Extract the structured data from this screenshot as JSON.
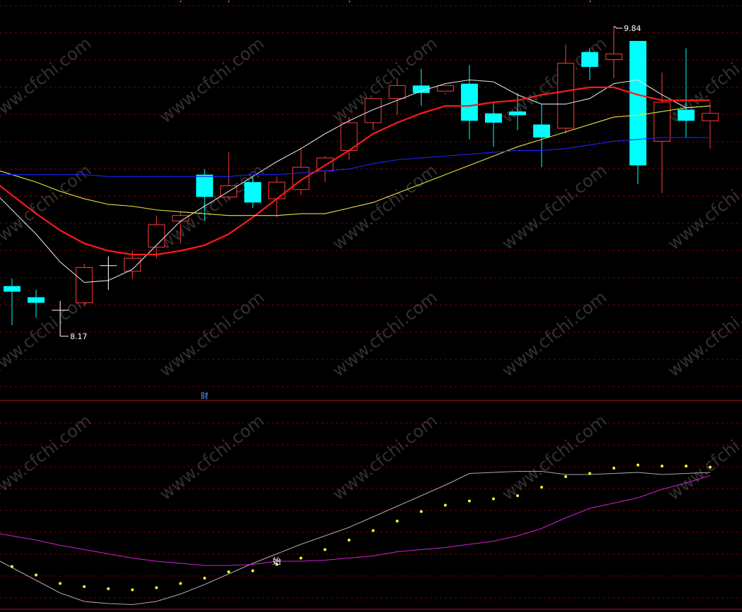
{
  "watermark": "www.cfchi.com",
  "colors": {
    "bg": "#000000",
    "grid": "#7a0000",
    "divider": "#b01020",
    "up": "#ff3b3b",
    "down": "#00ffff",
    "ma_white": "#e0e0e0",
    "ma_red": "#ff1a1a",
    "ma_yellow": "#e6e640",
    "ma_blue": "#2020ff",
    "ind_gray": "#a8a8a8",
    "ind_magenta": "#d020d0",
    "ind_dots": "#ffff20",
    "label": "#ffffff",
    "marker_blue": "#5a9cff"
  },
  "chart_data": [
    {
      "type": "candlestick",
      "panel": "main",
      "price_range": [
        7.9,
        9.95
      ],
      "annotations": [
        {
          "text": "9.84",
          "value": 9.84,
          "index": 25
        },
        {
          "text": "8.17",
          "value": 8.17,
          "index": 2
        }
      ],
      "marker_text": "财",
      "marker_index": 8,
      "candles": [
        {
          "o": 8.44,
          "h": 8.48,
          "l": 8.23,
          "c": 8.41,
          "dir": "down"
        },
        {
          "o": 8.38,
          "h": 8.42,
          "l": 8.27,
          "c": 8.35,
          "dir": "down"
        },
        {
          "o": 8.31,
          "h": 8.36,
          "l": 8.17,
          "c": 8.31,
          "dir": "flat"
        },
        {
          "o": 8.35,
          "h": 8.56,
          "l": 8.33,
          "c": 8.54,
          "dir": "up"
        },
        {
          "o": 8.55,
          "h": 8.6,
          "l": 8.42,
          "c": 8.55,
          "dir": "flat"
        },
        {
          "o": 8.52,
          "h": 8.63,
          "l": 8.48,
          "c": 8.59,
          "dir": "up"
        },
        {
          "o": 8.65,
          "h": 8.82,
          "l": 8.59,
          "c": 8.77,
          "dir": "up"
        },
        {
          "o": 8.79,
          "h": 8.84,
          "l": 8.67,
          "c": 8.82,
          "dir": "up"
        },
        {
          "o": 9.04,
          "h": 9.07,
          "l": 8.79,
          "c": 8.92,
          "dir": "down"
        },
        {
          "o": 8.92,
          "h": 9.16,
          "l": 8.9,
          "c": 8.98,
          "dir": "up"
        },
        {
          "o": 9.0,
          "h": 9.03,
          "l": 8.86,
          "c": 8.89,
          "dir": "down"
        },
        {
          "o": 8.91,
          "h": 9.03,
          "l": 8.81,
          "c": 9.0,
          "dir": "up"
        },
        {
          "o": 8.96,
          "h": 9.18,
          "l": 8.93,
          "c": 9.08,
          "dir": "up"
        },
        {
          "o": 9.06,
          "h": 9.14,
          "l": 9.0,
          "c": 9.13,
          "dir": "up"
        },
        {
          "o": 9.17,
          "h": 9.35,
          "l": 9.12,
          "c": 9.32,
          "dir": "up"
        },
        {
          "o": 9.32,
          "h": 9.44,
          "l": 9.28,
          "c": 9.45,
          "dir": "up"
        },
        {
          "o": 9.45,
          "h": 9.56,
          "l": 9.36,
          "c": 9.52,
          "dir": "up"
        },
        {
          "o": 9.52,
          "h": 9.61,
          "l": 9.41,
          "c": 9.48,
          "dir": "down"
        },
        {
          "o": 9.49,
          "h": 9.47,
          "l": 9.48,
          "c": 9.52,
          "dir": "up"
        },
        {
          "o": 9.53,
          "h": 9.63,
          "l": 9.23,
          "c": 9.33,
          "dir": "down"
        },
        {
          "o": 9.37,
          "h": 9.43,
          "l": 9.19,
          "c": 9.32,
          "dir": "down"
        },
        {
          "o": 9.38,
          "h": 9.48,
          "l": 9.28,
          "c": 9.36,
          "dir": "down"
        },
        {
          "o": 9.31,
          "h": 9.42,
          "l": 9.08,
          "c": 9.24,
          "dir": "down"
        },
        {
          "o": 9.29,
          "h": 9.74,
          "l": 9.26,
          "c": 9.64,
          "dir": "up"
        },
        {
          "o": 9.7,
          "h": 9.72,
          "l": 9.55,
          "c": 9.62,
          "dir": "down"
        },
        {
          "o": 9.66,
          "h": 9.84,
          "l": 9.56,
          "c": 9.69,
          "dir": "up"
        },
        {
          "o": 9.76,
          "h": 9.76,
          "l": 8.99,
          "c": 9.09,
          "dir": "down"
        },
        {
          "o": 9.22,
          "h": 9.59,
          "l": 8.94,
          "c": 9.43,
          "dir": "up"
        },
        {
          "o": 9.39,
          "h": 9.72,
          "l": 9.24,
          "c": 9.33,
          "dir": "down"
        },
        {
          "o": 9.33,
          "h": 9.43,
          "l": 9.18,
          "c": 9.37,
          "dir": "up"
        }
      ],
      "series": [
        {
          "color_key": "ma_white",
          "values": [
            8.85,
            8.72,
            8.57,
            8.46,
            8.47,
            8.53,
            8.66,
            8.79,
            8.87,
            8.95,
            9.03,
            9.11,
            9.18,
            9.26,
            9.33,
            9.39,
            9.44,
            9.49,
            9.53,
            9.55,
            9.54,
            9.47,
            9.42,
            9.42,
            9.45,
            9.53,
            9.55,
            9.47,
            9.4,
            9.41
          ]
        },
        {
          "color_key": "ma_red",
          "values": [
            8.93,
            8.83,
            8.74,
            8.67,
            8.63,
            8.61,
            8.61,
            8.63,
            8.66,
            8.72,
            8.81,
            8.91,
            9.01,
            9.09,
            9.17,
            9.26,
            9.32,
            9.37,
            9.41,
            9.41,
            9.43,
            9.44,
            9.47,
            9.49,
            9.51,
            9.51,
            9.47,
            9.44,
            9.44,
            9.44
          ]
        },
        {
          "color_key": "ma_yellow",
          "values": [
            9.04,
            9.0,
            8.95,
            8.91,
            8.88,
            8.87,
            8.85,
            8.84,
            8.83,
            8.82,
            8.82,
            8.82,
            8.83,
            8.83,
            8.86,
            8.89,
            8.94,
            8.99,
            9.04,
            9.09,
            9.14,
            9.19,
            9.23,
            9.27,
            9.31,
            9.35,
            9.36,
            9.38,
            9.4,
            9.41
          ]
        },
        {
          "color_key": "ma_blue",
          "values": [
            9.04,
            9.04,
            9.04,
            9.04,
            9.03,
            9.03,
            9.03,
            9.03,
            9.03,
            9.03,
            9.04,
            9.04,
            9.05,
            9.06,
            9.07,
            9.1,
            9.12,
            9.13,
            9.14,
            9.15,
            9.16,
            9.17,
            9.17,
            9.18,
            9.2,
            9.22,
            9.23,
            9.24,
            9.24,
            9.24
          ]
        }
      ]
    },
    {
      "type": "line",
      "panel": "indicator",
      "y_range": [
        0,
        100
      ],
      "label_text": "始",
      "label_index": 11,
      "series": [
        {
          "color_key": "ind_gray",
          "values": [
            38,
            26,
            14,
            6,
            4,
            3,
            6,
            13,
            22,
            32,
            42,
            51,
            60,
            68,
            76,
            86,
            96,
            106,
            116,
            127,
            128,
            129,
            129,
            126,
            126,
            127,
            128,
            126,
            127,
            128
          ]
        },
        {
          "color_key": "ind_magenta",
          "values": [
            68,
            64,
            59,
            55,
            51,
            47,
            44,
            42,
            40,
            40,
            41,
            44,
            44,
            45,
            47,
            49,
            53,
            55,
            57,
            60,
            63,
            68,
            75,
            85,
            94,
            99,
            104,
            112,
            118,
            125
          ]
        }
      ],
      "dots": {
        "color_key": "ind_dots",
        "values": [
          39,
          31,
          23,
          20,
          18,
          17,
          19,
          23,
          28,
          34,
          35,
          41,
          47,
          55,
          64,
          73,
          82,
          91,
          97,
          101,
          103,
          106,
          114,
          124,
          127,
          132,
          135,
          134,
          134,
          133
        ]
      }
    }
  ]
}
